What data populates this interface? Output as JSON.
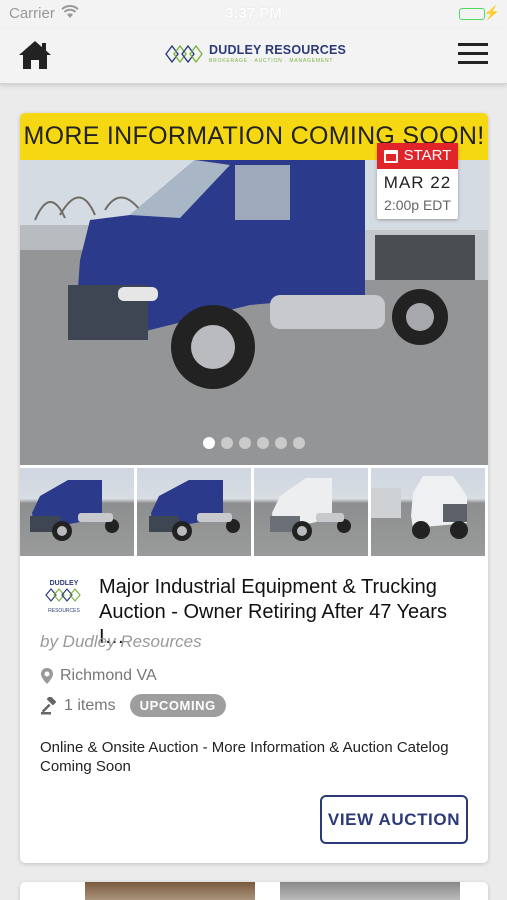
{
  "status_bar": {
    "carrier": "Carrier",
    "time": "3:37 PM",
    "battery_level": 1.0
  },
  "nav": {
    "logo_name": "DUDLEY RESOURCES",
    "logo_tagline": "BROKERAGE · AUCTION · MANAGEMENT",
    "home_icon": "home-icon",
    "menu_icon": "hamburger-menu-icon"
  },
  "listing": {
    "banner": "MORE INFORMATION COMING SOON!",
    "start_label": "START",
    "start_date": "MAR 22",
    "start_time": "2:00p EDT",
    "carousel_count": 6,
    "carousel_active": 1,
    "org_logo_name": "DUDLEY",
    "org_logo_sub": "RESOURCES",
    "title": "Major Industrial Equipment & Trucking Auction - Owner Retiring After 47 Years I…",
    "byline": "by Dudley Resources",
    "location": "Richmond VA",
    "items": "1 items",
    "status": "UPCOMING",
    "description": "Online & Onsite Auction - More Information & Auction Catelog Coming Soon",
    "button": "VIEW AUCTION",
    "colors": {
      "banner": "#f6d812",
      "start": "#e0242a",
      "brand": "#2c3a78",
      "badge": "#9e9e9e"
    }
  }
}
